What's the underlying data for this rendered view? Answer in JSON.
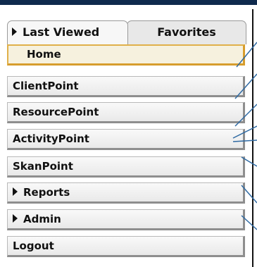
{
  "tabs": {
    "last_viewed": "Last Viewed",
    "favorites": "Favorites"
  },
  "menu": {
    "items": [
      {
        "label": "Home"
      },
      {
        "label": "ClientPoint"
      },
      {
        "label": "ResourcePoint"
      },
      {
        "label": "ActivityPoint"
      },
      {
        "label": "SkanPoint"
      },
      {
        "label": "Reports"
      },
      {
        "label": "Admin"
      },
      {
        "label": "Logout"
      }
    ]
  },
  "colors": {
    "top_bar": "#0f2a4d",
    "active_border": "#e0b04a"
  }
}
